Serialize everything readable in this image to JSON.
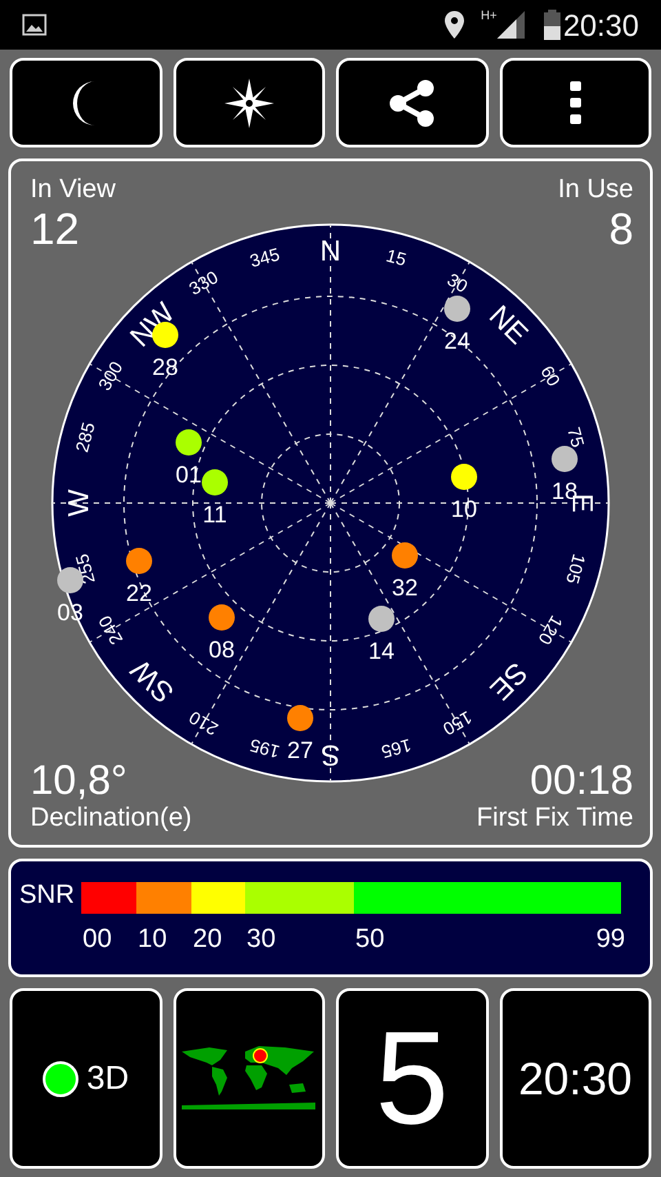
{
  "status_bar": {
    "network": "H+",
    "time": "20:30"
  },
  "toolbar": [
    {
      "kind": "night"
    },
    {
      "kind": "compass"
    },
    {
      "kind": "share"
    },
    {
      "kind": "menu"
    }
  ],
  "sky": {
    "in_view_label": "In View",
    "in_view": "12",
    "in_use_label": "In Use",
    "in_use": "8",
    "directions": [
      "N",
      "NE",
      "E",
      "SE",
      "S",
      "SW",
      "W",
      "NW"
    ],
    "degrees": [
      "15",
      "30",
      "60",
      "75",
      "105",
      "120",
      "150",
      "165",
      "195",
      "210",
      "240",
      "255",
      "285",
      "300",
      "330",
      "345"
    ],
    "satellites": [
      {
        "id": "28",
        "color": "#ffff00"
      },
      {
        "id": "24",
        "color": "#c0c0c0"
      },
      {
        "id": "01",
        "color": "#aaff00"
      },
      {
        "id": "11",
        "color": "#aaff00"
      },
      {
        "id": "10",
        "color": "#ffff00"
      },
      {
        "id": "18",
        "color": "#c0c0c0"
      },
      {
        "id": "03",
        "color": "#c0c0c0"
      },
      {
        "id": "22",
        "color": "#ff8000"
      },
      {
        "id": "32",
        "color": "#ff8000"
      },
      {
        "id": "08",
        "color": "#ff8000"
      },
      {
        "id": "14",
        "color": "#c0c0c0"
      },
      {
        "id": "27",
        "color": "#ff8000"
      }
    ],
    "declination": "10,8°",
    "declination_label": "Declination(e)",
    "fix_time": "00:18",
    "fix_time_label": "First Fix Time"
  },
  "snr": {
    "label": "SNR",
    "segments": [
      {
        "label": "00",
        "color": "#ff0000"
      },
      {
        "label": "10",
        "color": "#ff8000"
      },
      {
        "label": "20",
        "color": "#ffff00"
      },
      {
        "label": "30",
        "color": "#aaff00"
      },
      {
        "label": "50",
        "color": "#00ff00"
      }
    ],
    "end_label": "99"
  },
  "tiles": {
    "fix": {
      "label": "3D",
      "color": "#00ff00"
    },
    "satellites_count": "5",
    "clock": "20:30"
  }
}
